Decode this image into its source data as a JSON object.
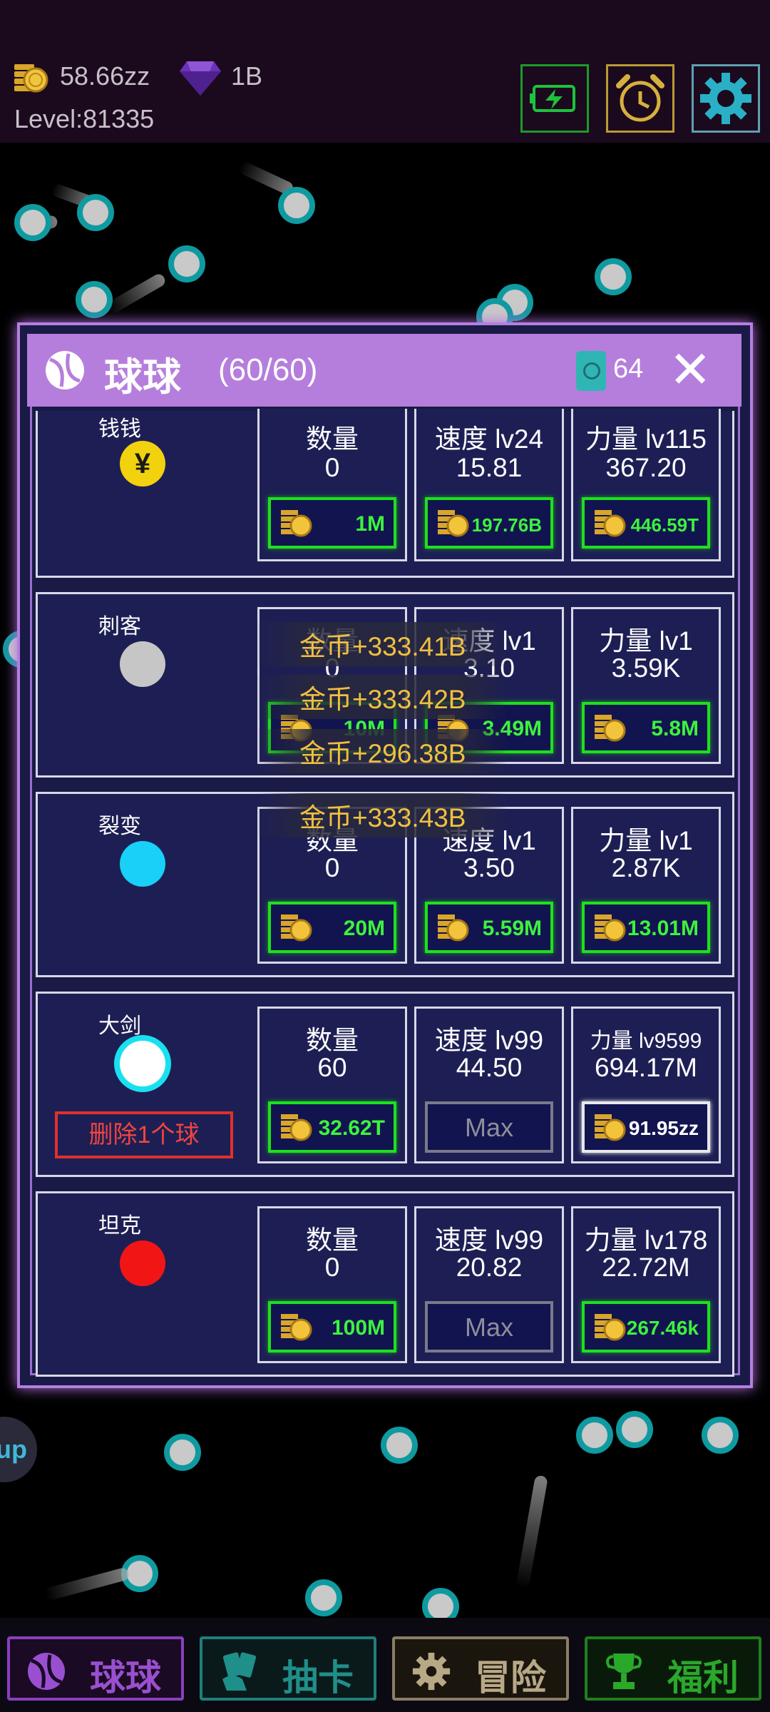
{
  "header": {
    "coins": "58.66zz",
    "gems": "1B",
    "level": "Level:81335",
    "buttons": [
      "battery-button",
      "alarm-button",
      "settings-button"
    ]
  },
  "panel": {
    "title": "球球",
    "count": "(60/60)",
    "tickets": "64"
  },
  "rows": [
    {
      "name": "钱钱",
      "ball_color": "#f2d10f",
      "ball_glyph": "¥",
      "qty_label": "数量",
      "qty_value": "0",
      "qty_price": "1M",
      "speed_label": "速度 lv24",
      "speed_value": "15.81",
      "speed_price": "197.76B",
      "power_label": "力量 lv115",
      "power_value": "367.20",
      "power_price": "446.59T"
    },
    {
      "name": "刺客",
      "ball_color": "#c6c6c6",
      "qty_label": "数量",
      "qty_value": "0",
      "qty_price": "10M",
      "speed_label": "速度 lv1",
      "speed_value": "3.10",
      "speed_price": "3.49M",
      "power_label": "力量 lv1",
      "power_value": "3.59K",
      "power_price": "5.8M"
    },
    {
      "name": "裂变",
      "ball_color": "#19d0f8",
      "qty_label": "数量",
      "qty_value": "0",
      "qty_price": "20M",
      "speed_label": "速度 lv1",
      "speed_value": "3.50",
      "speed_price": "5.59M",
      "power_label": "力量 lv1",
      "power_value": "2.87K",
      "power_price": "13.01M"
    },
    {
      "name": "大剑",
      "ball_color": "#ffffff",
      "delete_label": "删除1个球",
      "qty_label": "数量",
      "qty_value": "60",
      "qty_price": "32.62T",
      "speed_label": "速度 lv99",
      "speed_value": "44.50",
      "speed_price": "Max",
      "power_label": "力量 lv9599",
      "power_value": "694.17M",
      "power_price": "91.95zz"
    },
    {
      "name": "坦克",
      "ball_color": "#f21515",
      "qty_label": "数量",
      "qty_value": "0",
      "qty_price": "100M",
      "speed_label": "速度 lv99",
      "speed_value": "20.82",
      "speed_price": "Max",
      "power_label": "力量 lv178",
      "power_value": "22.72M",
      "power_price": "267.46k"
    }
  ],
  "floating_texts": [
    "金币+333.41B",
    "金币+333.42B",
    "金币+296.38B",
    "金币+333.43B"
  ],
  "side_button": "up",
  "tabs": [
    {
      "label": "球球",
      "color": "#9a4fd0",
      "icon": "ball-icon"
    },
    {
      "label": "抽卡",
      "color": "#1f8f8a",
      "icon": "cards-icon"
    },
    {
      "label": "冒险",
      "color": "#b8a886",
      "icon": "gear-icon"
    },
    {
      "label": "福利",
      "color": "#2aa82a",
      "icon": "trophy-icon"
    }
  ]
}
